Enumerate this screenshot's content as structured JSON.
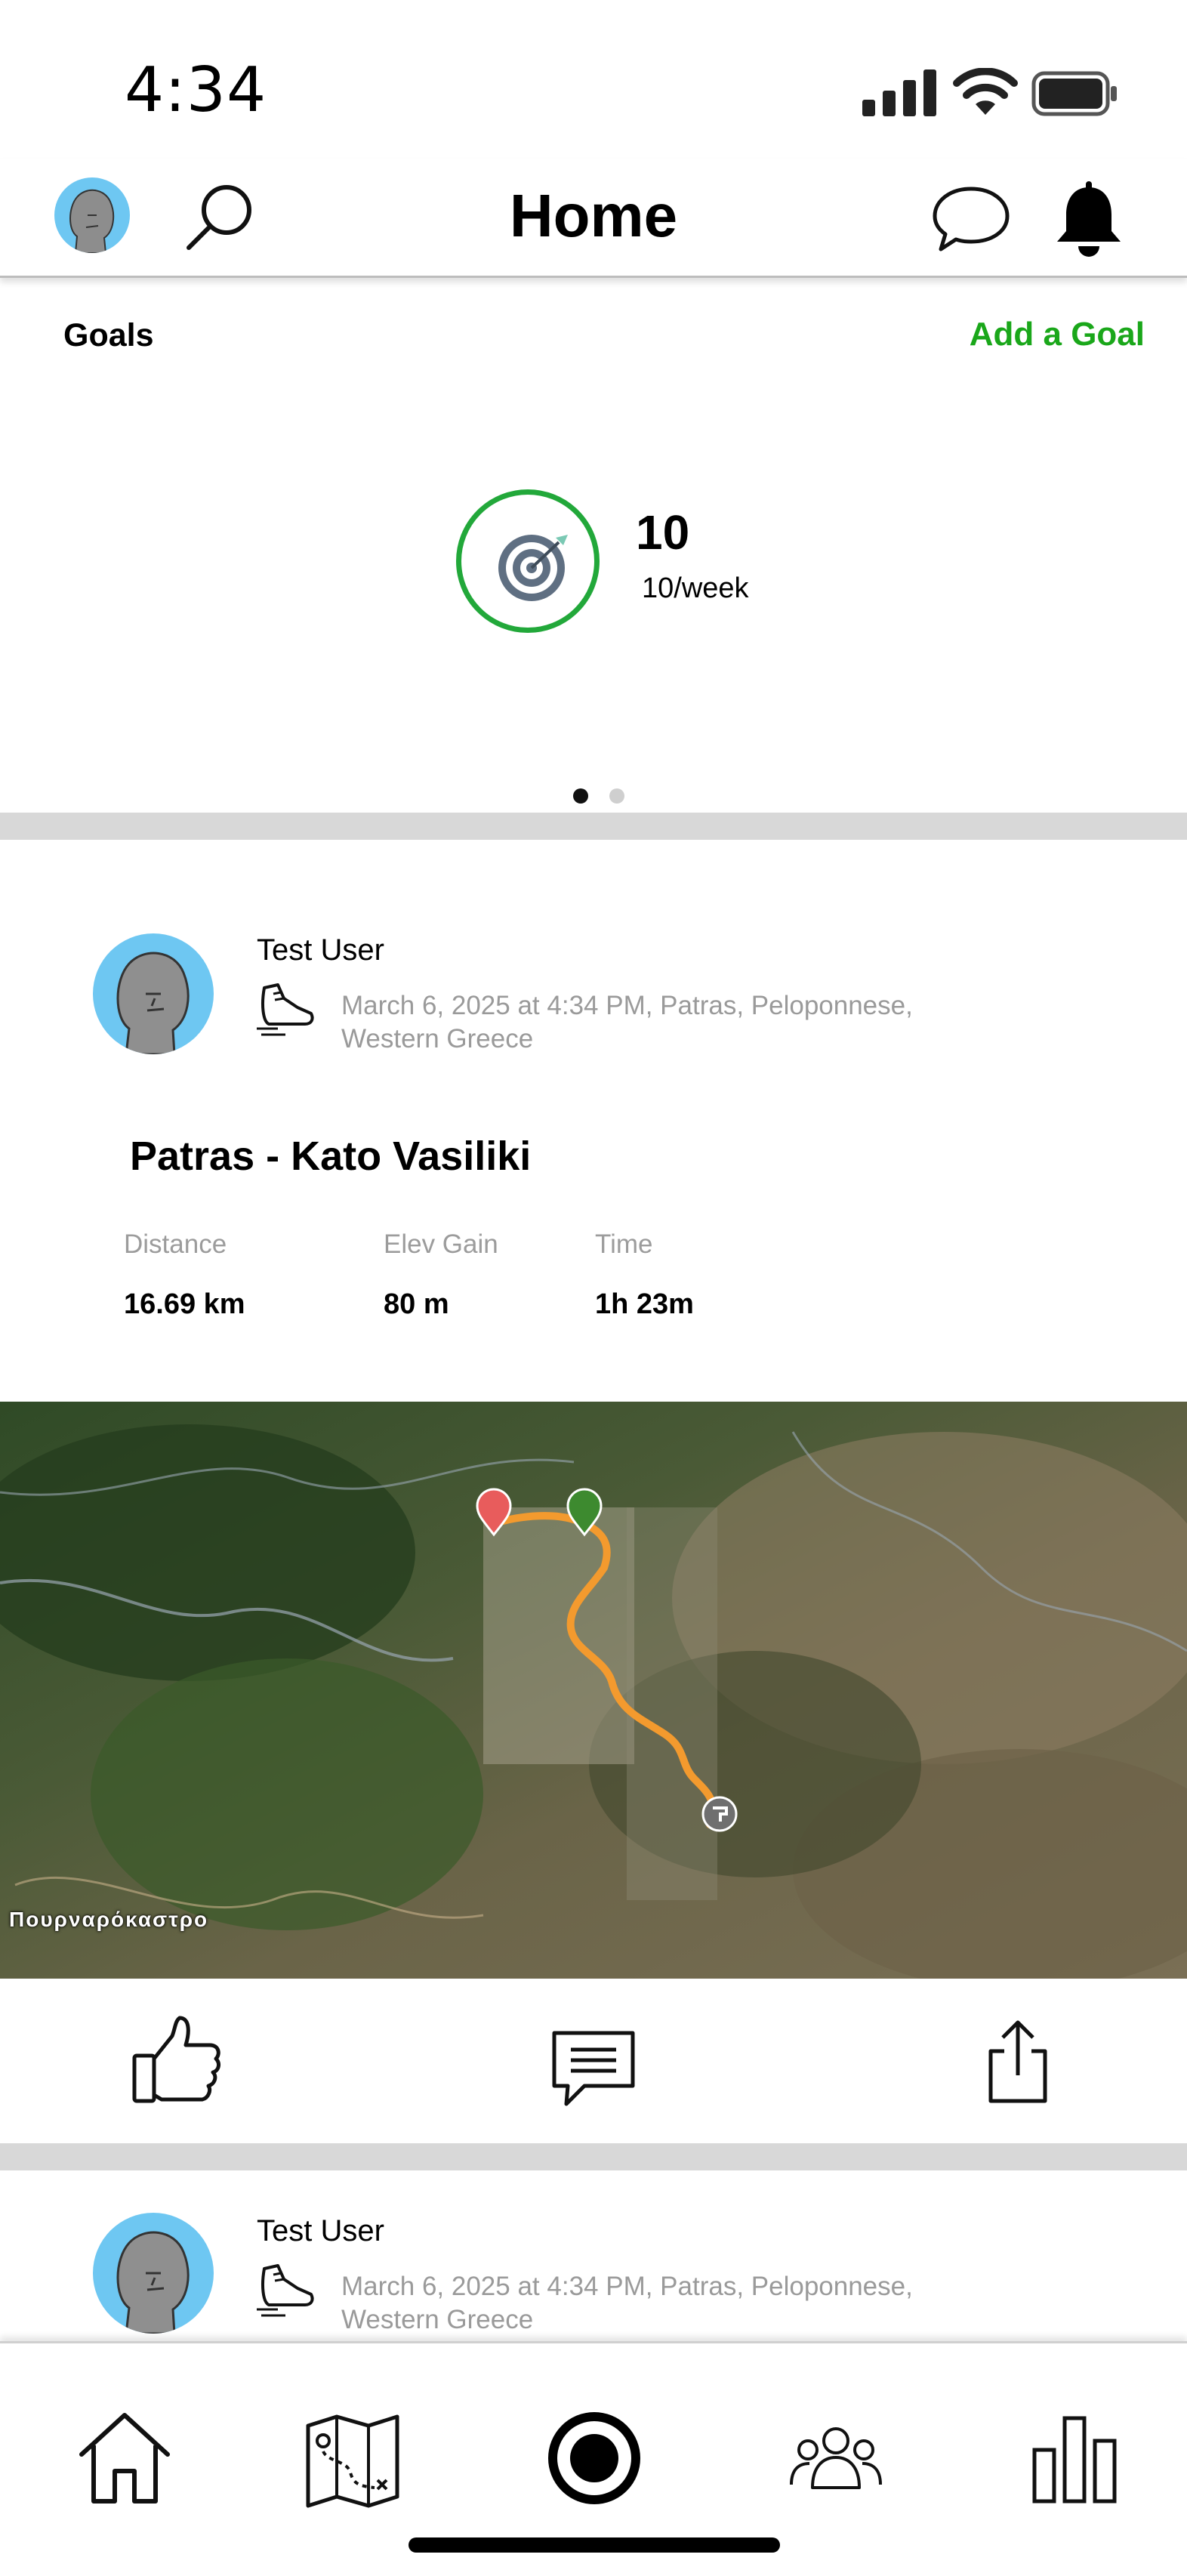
{
  "status_bar": {
    "time": "4:34"
  },
  "header": {
    "title": "Home"
  },
  "goals": {
    "label": "Goals",
    "add_label": "Add a Goal",
    "count": "10",
    "rate": "10/week",
    "page_index": 0,
    "page_count": 2
  },
  "posts": [
    {
      "user": "Test User",
      "meta": "March 6, 2025 at 4:34 PM, Patras, Peloponnese, Western Greece",
      "title": "Patras - Kato Vasiliki",
      "stats": [
        {
          "label": "Distance",
          "value": "16.69 km"
        },
        {
          "label": "Elev Gain",
          "value": "80 m"
        },
        {
          "label": "Time",
          "value": "1h 23m"
        }
      ],
      "map_label": "Πουρναρόκαστρο"
    },
    {
      "user": "Test User",
      "meta": "March 6, 2025 at 4:34 PM, Patras, Peloponnese, Western Greece"
    }
  ],
  "colors": {
    "accent": "#1aa71a",
    "goal_ring": "#22a83a",
    "route": "#f39a2e",
    "avatar_bg": "#6ec7f2"
  }
}
